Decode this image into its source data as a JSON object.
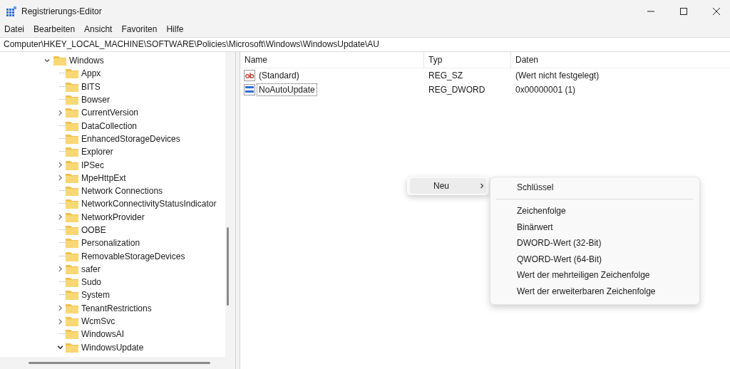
{
  "window": {
    "title": "Registrierungs-Editor"
  },
  "menu": [
    "Datei",
    "Bearbeiten",
    "Ansicht",
    "Favoriten",
    "Hilfe"
  ],
  "address": "Computer\\HKEY_LOCAL_MACHINE\\SOFTWARE\\Policies\\Microsoft\\Windows\\WindowsUpdate\\AU",
  "tree": {
    "label": "Windows",
    "expanded": true,
    "children": [
      {
        "label": "Appx",
        "expandable": false
      },
      {
        "label": "BITS",
        "expandable": false
      },
      {
        "label": "Bowser",
        "expandable": false
      },
      {
        "label": "CurrentVersion",
        "expandable": true,
        "expanded": false
      },
      {
        "label": "DataCollection",
        "expandable": false
      },
      {
        "label": "EnhancedStorageDevices",
        "expandable": false
      },
      {
        "label": "Explorer",
        "expandable": false
      },
      {
        "label": "IPSec",
        "expandable": true,
        "expanded": false
      },
      {
        "label": "MpeHttpExt",
        "expandable": true,
        "expanded": false
      },
      {
        "label": "Network Connections",
        "expandable": false
      },
      {
        "label": "NetworkConnectivityStatusIndicator",
        "expandable": false
      },
      {
        "label": "NetworkProvider",
        "expandable": true,
        "expanded": false
      },
      {
        "label": "OOBE",
        "expandable": false
      },
      {
        "label": "Personalization",
        "expandable": false
      },
      {
        "label": "RemovableStorageDevices",
        "expandable": false
      },
      {
        "label": "safer",
        "expandable": true,
        "expanded": false
      },
      {
        "label": "Sudo",
        "expandable": false
      },
      {
        "label": "System",
        "expandable": false
      },
      {
        "label": "TenantRestrictions",
        "expandable": true,
        "expanded": false
      },
      {
        "label": "WcmSvc",
        "expandable": true,
        "expanded": false
      },
      {
        "label": "WindowsAI",
        "expandable": false
      },
      {
        "label": "WindowsUpdate",
        "expandable": true,
        "expanded": true
      }
    ]
  },
  "values": {
    "columns": [
      "Name",
      "Typ",
      "Daten"
    ],
    "rows": [
      {
        "kind": "string",
        "name": "(Standard)",
        "type": "REG_SZ",
        "data": "(Wert nicht festgelegt)",
        "focused": false
      },
      {
        "kind": "binary",
        "name": "NoAutoUpdate",
        "type": "REG_DWORD",
        "data": "0x00000001 (1)",
        "focused": true
      }
    ]
  },
  "context_menu": {
    "item": {
      "label": "Neu",
      "selected": true
    },
    "submenu": [
      {
        "label": "Schlüssel",
        "separator_after": true
      },
      {
        "label": "Zeichenfolge",
        "separator_after": false
      },
      {
        "label": "Binärwert",
        "separator_after": false
      },
      {
        "label": "DWORD-Wert (32-Bit)",
        "separator_after": false
      },
      {
        "label": "QWORD-Wert (64-Bit)",
        "separator_after": false
      },
      {
        "label": "Wert der mehrteiligen Zeichenfolge",
        "separator_after": false
      },
      {
        "label": "Wert der erweiterbaren Zeichenfolge",
        "separator_after": false
      }
    ]
  }
}
